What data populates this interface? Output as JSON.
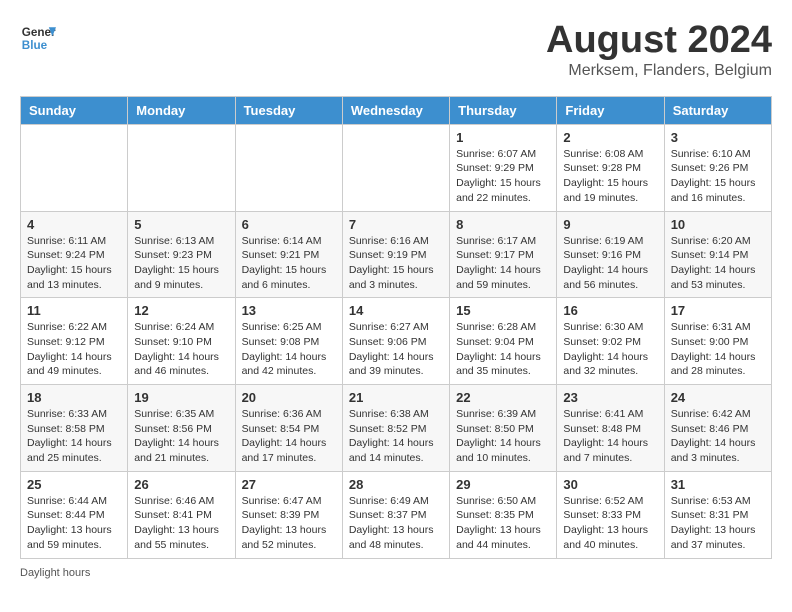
{
  "header": {
    "logo_general": "General",
    "logo_blue": "Blue",
    "title": "August 2024",
    "subtitle": "Merksem, Flanders, Belgium"
  },
  "days_of_week": [
    "Sunday",
    "Monday",
    "Tuesday",
    "Wednesday",
    "Thursday",
    "Friday",
    "Saturday"
  ],
  "weeks": [
    [
      {
        "day": "",
        "detail": ""
      },
      {
        "day": "",
        "detail": ""
      },
      {
        "day": "",
        "detail": ""
      },
      {
        "day": "",
        "detail": ""
      },
      {
        "day": "1",
        "detail": "Sunrise: 6:07 AM\nSunset: 9:29 PM\nDaylight: 15 hours\nand 22 minutes."
      },
      {
        "day": "2",
        "detail": "Sunrise: 6:08 AM\nSunset: 9:28 PM\nDaylight: 15 hours\nand 19 minutes."
      },
      {
        "day": "3",
        "detail": "Sunrise: 6:10 AM\nSunset: 9:26 PM\nDaylight: 15 hours\nand 16 minutes."
      }
    ],
    [
      {
        "day": "4",
        "detail": "Sunrise: 6:11 AM\nSunset: 9:24 PM\nDaylight: 15 hours\nand 13 minutes."
      },
      {
        "day": "5",
        "detail": "Sunrise: 6:13 AM\nSunset: 9:23 PM\nDaylight: 15 hours\nand 9 minutes."
      },
      {
        "day": "6",
        "detail": "Sunrise: 6:14 AM\nSunset: 9:21 PM\nDaylight: 15 hours\nand 6 minutes."
      },
      {
        "day": "7",
        "detail": "Sunrise: 6:16 AM\nSunset: 9:19 PM\nDaylight: 15 hours\nand 3 minutes."
      },
      {
        "day": "8",
        "detail": "Sunrise: 6:17 AM\nSunset: 9:17 PM\nDaylight: 14 hours\nand 59 minutes."
      },
      {
        "day": "9",
        "detail": "Sunrise: 6:19 AM\nSunset: 9:16 PM\nDaylight: 14 hours\nand 56 minutes."
      },
      {
        "day": "10",
        "detail": "Sunrise: 6:20 AM\nSunset: 9:14 PM\nDaylight: 14 hours\nand 53 minutes."
      }
    ],
    [
      {
        "day": "11",
        "detail": "Sunrise: 6:22 AM\nSunset: 9:12 PM\nDaylight: 14 hours\nand 49 minutes."
      },
      {
        "day": "12",
        "detail": "Sunrise: 6:24 AM\nSunset: 9:10 PM\nDaylight: 14 hours\nand 46 minutes."
      },
      {
        "day": "13",
        "detail": "Sunrise: 6:25 AM\nSunset: 9:08 PM\nDaylight: 14 hours\nand 42 minutes."
      },
      {
        "day": "14",
        "detail": "Sunrise: 6:27 AM\nSunset: 9:06 PM\nDaylight: 14 hours\nand 39 minutes."
      },
      {
        "day": "15",
        "detail": "Sunrise: 6:28 AM\nSunset: 9:04 PM\nDaylight: 14 hours\nand 35 minutes."
      },
      {
        "day": "16",
        "detail": "Sunrise: 6:30 AM\nSunset: 9:02 PM\nDaylight: 14 hours\nand 32 minutes."
      },
      {
        "day": "17",
        "detail": "Sunrise: 6:31 AM\nSunset: 9:00 PM\nDaylight: 14 hours\nand 28 minutes."
      }
    ],
    [
      {
        "day": "18",
        "detail": "Sunrise: 6:33 AM\nSunset: 8:58 PM\nDaylight: 14 hours\nand 25 minutes."
      },
      {
        "day": "19",
        "detail": "Sunrise: 6:35 AM\nSunset: 8:56 PM\nDaylight: 14 hours\nand 21 minutes."
      },
      {
        "day": "20",
        "detail": "Sunrise: 6:36 AM\nSunset: 8:54 PM\nDaylight: 14 hours\nand 17 minutes."
      },
      {
        "day": "21",
        "detail": "Sunrise: 6:38 AM\nSunset: 8:52 PM\nDaylight: 14 hours\nand 14 minutes."
      },
      {
        "day": "22",
        "detail": "Sunrise: 6:39 AM\nSunset: 8:50 PM\nDaylight: 14 hours\nand 10 minutes."
      },
      {
        "day": "23",
        "detail": "Sunrise: 6:41 AM\nSunset: 8:48 PM\nDaylight: 14 hours\nand 7 minutes."
      },
      {
        "day": "24",
        "detail": "Sunrise: 6:42 AM\nSunset: 8:46 PM\nDaylight: 14 hours\nand 3 minutes."
      }
    ],
    [
      {
        "day": "25",
        "detail": "Sunrise: 6:44 AM\nSunset: 8:44 PM\nDaylight: 13 hours\nand 59 minutes."
      },
      {
        "day": "26",
        "detail": "Sunrise: 6:46 AM\nSunset: 8:41 PM\nDaylight: 13 hours\nand 55 minutes."
      },
      {
        "day": "27",
        "detail": "Sunrise: 6:47 AM\nSunset: 8:39 PM\nDaylight: 13 hours\nand 52 minutes."
      },
      {
        "day": "28",
        "detail": "Sunrise: 6:49 AM\nSunset: 8:37 PM\nDaylight: 13 hours\nand 48 minutes."
      },
      {
        "day": "29",
        "detail": "Sunrise: 6:50 AM\nSunset: 8:35 PM\nDaylight: 13 hours\nand 44 minutes."
      },
      {
        "day": "30",
        "detail": "Sunrise: 6:52 AM\nSunset: 8:33 PM\nDaylight: 13 hours\nand 40 minutes."
      },
      {
        "day": "31",
        "detail": "Sunrise: 6:53 AM\nSunset: 8:31 PM\nDaylight: 13 hours\nand 37 minutes."
      }
    ]
  ],
  "footer": {
    "daylight_label": "Daylight hours"
  }
}
